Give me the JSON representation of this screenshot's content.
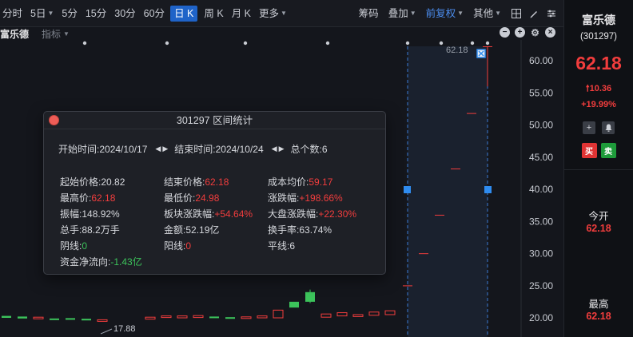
{
  "toolbar": {
    "periods": [
      "分时",
      "5日",
      "5分",
      "15分",
      "30分",
      "60分",
      "日 K",
      "周 K",
      "月 K",
      "更多"
    ],
    "active_period": "日 K",
    "right": {
      "chips": "筹码",
      "overlay": "叠加",
      "adjust": "前复权",
      "other": "其他"
    }
  },
  "subbar": {
    "stock_name": "富乐德",
    "indicator": "指标"
  },
  "chart": {
    "price_ticks": [
      "60.00",
      "55.00",
      "50.00",
      "45.00",
      "40.00",
      "35.00",
      "30.00",
      "25.00",
      "20.00"
    ],
    "range_high_label": "62.18",
    "low_label": "17.88",
    "colors": {
      "up": "#f23d3d",
      "down": "#3cc35b",
      "selection": "#4c8ff2"
    }
  },
  "popup": {
    "title": "301297 区间统计",
    "start_label": "开始时间: ",
    "start_value": "2024/10/17",
    "end_label": "结束时间: ",
    "end_value": "2024/10/24",
    "count_label": "总个数: ",
    "count_value": "6",
    "stats": {
      "open_price_label": "起始价格: ",
      "open_price": "20.82",
      "close_price_label": "结束价格: ",
      "close_price": "62.18",
      "avg_cost_label": "成本均价: ",
      "avg_cost": "59.17",
      "high_label": "最高价: ",
      "high": "62.18",
      "low_label": "最低价: ",
      "low": "24.98",
      "change_label": "涨跌幅: ",
      "change": "+198.66%",
      "amplitude_label": "振幅: ",
      "amplitude": "148.92%",
      "sector_change_label": "板块涨跌幅: ",
      "sector_change": "+54.64%",
      "index_change_label": "大盘涨跌幅: ",
      "index_change": "+22.30%",
      "volume_label": "总手: ",
      "volume": "88.2万手",
      "amount_label": "金额: ",
      "amount": "52.19亿",
      "turnover_label": "换手率: ",
      "turnover": "63.74%",
      "down_days_label": "阴线: ",
      "down_days": "0",
      "up_days_label": "阳线: ",
      "up_days": "0",
      "flat_days_label": "平线: ",
      "flat_days": "6",
      "net_flow_label": "资金净流向: ",
      "net_flow": "-1.43亿"
    }
  },
  "panel": {
    "name": "富乐德",
    "code": "(301297)",
    "price": "62.18",
    "change": "10.36",
    "change_pct": "+19.99%",
    "buy": "买",
    "sell": "卖",
    "open_label": "今开",
    "open_value": "62.18",
    "high_label": "最高",
    "high_value": "62.18"
  }
}
